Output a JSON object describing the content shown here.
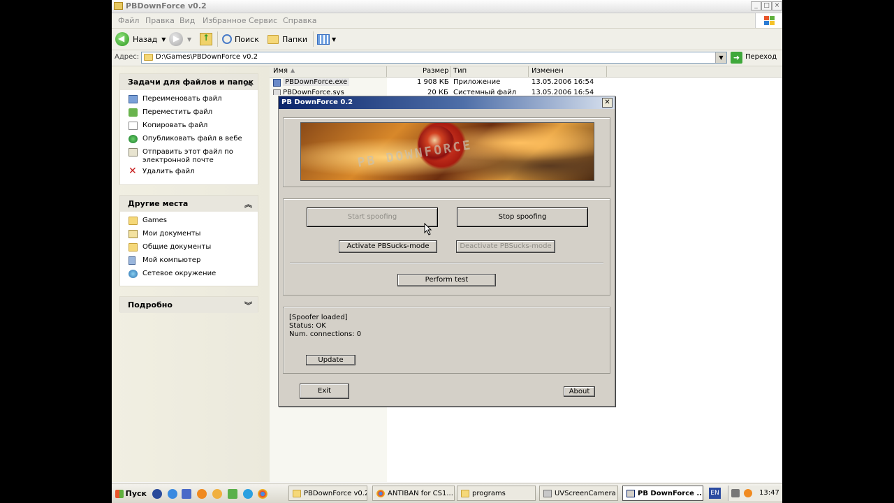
{
  "window": {
    "title": "PBDownForce v0.2"
  },
  "menu": [
    "Файл",
    "Правка",
    "Вид",
    "Избранное",
    "Сервис",
    "Справка"
  ],
  "toolbar": {
    "back": "Назад",
    "search": "Поиск",
    "folders": "Папки"
  },
  "address": {
    "label": "Адрес:",
    "value": "D:\\Games\\PBDownForce v0.2",
    "go": "Переход"
  },
  "tasks_panel": {
    "title": "Задачи для файлов и папок",
    "items": [
      "Переименовать файл",
      "Переместить файл",
      "Копировать файл",
      "Опубликовать файл в вебе",
      "Отправить этот файл по",
      "электронной почте",
      "Удалить файл"
    ]
  },
  "places_panel": {
    "title": "Другие места",
    "items": [
      "Games",
      "Мои документы",
      "Общие документы",
      "Мой компьютер",
      "Сетевое окружение"
    ]
  },
  "details_panel": {
    "title": "Подробно"
  },
  "columns": {
    "name": "Имя",
    "size": "Размер",
    "type": "Тип",
    "modified": "Изменен"
  },
  "files": [
    {
      "name": "PBDownForce.exe",
      "size": "1 908 КБ",
      "type": "Приложение",
      "modified": "13.05.2006 16:54"
    },
    {
      "name": "PBDownForce.sys",
      "size": "20 КБ",
      "type": "Системный файл",
      "modified": "13.05.2006 16:54"
    }
  ],
  "dialog": {
    "title": "PB DownForce 0.2",
    "start": "Start spoofing",
    "stop": "Stop spoofing",
    "activate": "Activate PBSucks-mode",
    "deactivate": "Deactivate PBSucks-mode",
    "perform": "Perform test",
    "status_lines": [
      "[Spoofer loaded]",
      "Status: OK",
      "Num. connections: 0"
    ],
    "update": "Update",
    "exit": "Exit",
    "about": "About"
  },
  "taskbar": {
    "start": "Пуск",
    "tasks": [
      "PBDownForce v0.2",
      "ANTIBAN for CS1...",
      "programs",
      "UVScreenCamera",
      "PB DownForce ..."
    ],
    "lang": "EN",
    "clock": "13:47"
  }
}
